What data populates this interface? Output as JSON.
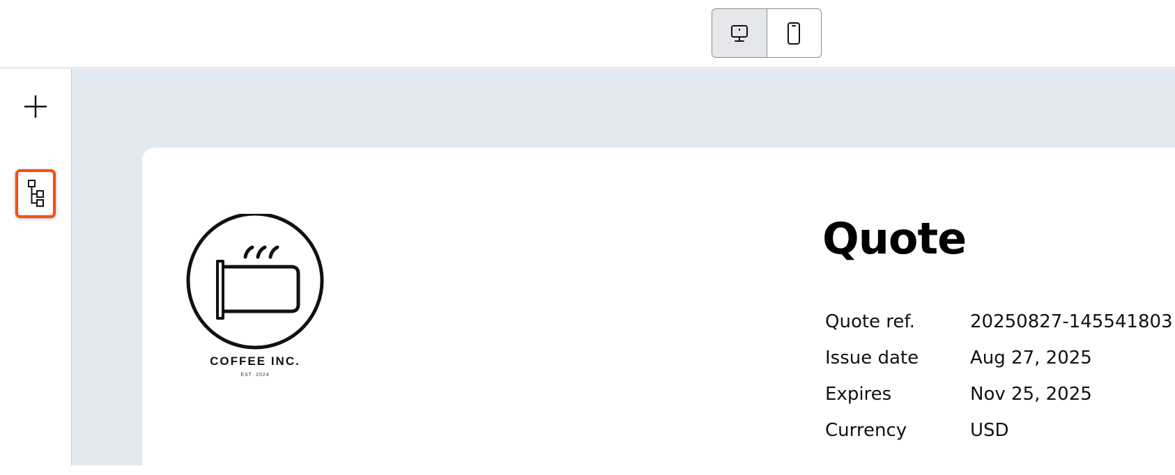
{
  "toolbar": {
    "view_modes": [
      {
        "name": "desktop",
        "icon": "monitor-icon",
        "active": true
      },
      {
        "name": "mobile",
        "icon": "phone-icon",
        "active": false
      }
    ]
  },
  "sidebar": {
    "items": [
      {
        "icon": "plus-icon",
        "highlighted": false
      },
      {
        "icon": "tree-structure-icon",
        "highlighted": true,
        "highlight_color": "#ff4a12"
      }
    ]
  },
  "canvas": {
    "background": "#e1e8f0"
  },
  "document": {
    "logo": {
      "name": "COFFEE INC.",
      "est": "EST. 2024"
    },
    "title": "Quote",
    "meta": [
      {
        "label": "Quote ref.",
        "value": "20250827-145541803"
      },
      {
        "label": "Issue date",
        "value": "Aug 27, 2025"
      },
      {
        "label": "Expires",
        "value": "Nov 25, 2025"
      },
      {
        "label": "Currency",
        "value": "USD"
      }
    ]
  }
}
